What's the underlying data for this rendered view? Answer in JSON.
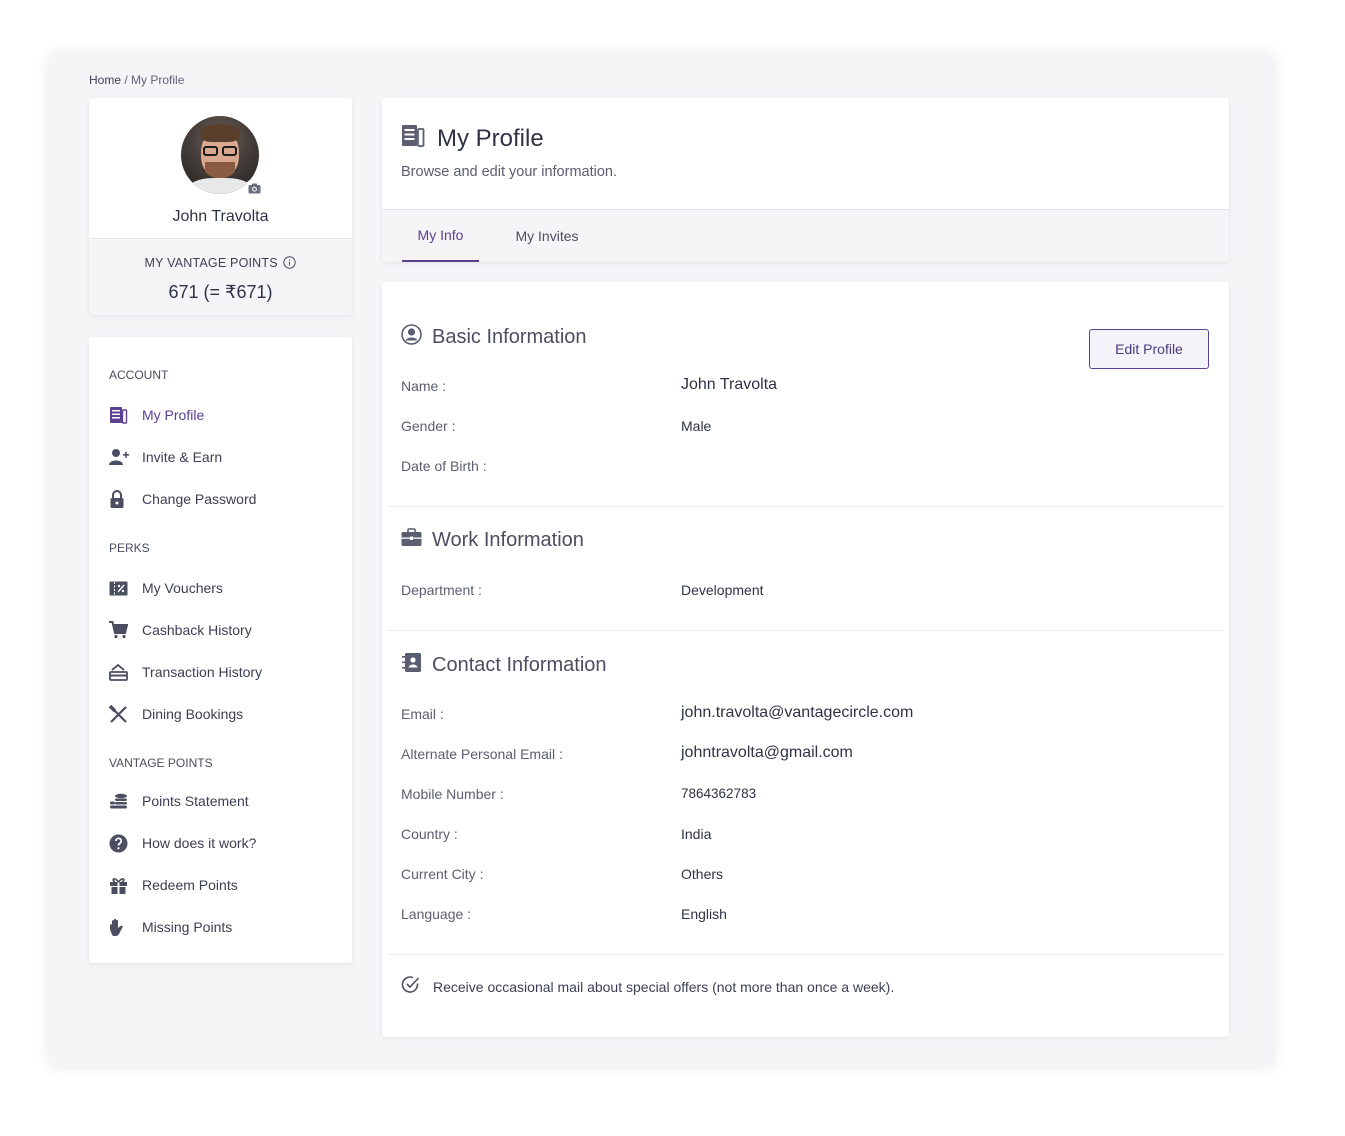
{
  "breadcrumb": {
    "home": "Home",
    "separator": " / ",
    "current": "My Profile"
  },
  "profile": {
    "name": "John Travolta",
    "points_label": "MY VANTAGE POINTS",
    "points_value": "671 (= ₹671)"
  },
  "sidebar": {
    "sections": {
      "account": "ACCOUNT",
      "perks": "PERKS",
      "vantage_points": "VANTAGE POINTS"
    },
    "items": [
      {
        "label": "My Profile",
        "icon": "profile-icon"
      },
      {
        "label": "Invite & Earn",
        "icon": "add-user-icon"
      },
      {
        "label": "Change Password",
        "icon": "lock-icon"
      },
      {
        "label": "My Vouchers",
        "icon": "voucher-icon"
      },
      {
        "label": "Cashback History",
        "icon": "cart-icon"
      },
      {
        "label": "Transaction History",
        "icon": "transaction-icon"
      },
      {
        "label": "Dining Bookings",
        "icon": "cutlery-icon"
      },
      {
        "label": "Points Statement",
        "icon": "coins-icon"
      },
      {
        "label": "How does it work?",
        "icon": "question-icon"
      },
      {
        "label": "Redeem Points",
        "icon": "gift-icon"
      },
      {
        "label": "Missing Points",
        "icon": "hand-icon"
      }
    ]
  },
  "header": {
    "title": "My Profile",
    "subtitle": "Browse and edit your information.",
    "tabs": [
      {
        "label": "My Info"
      },
      {
        "label": "My Invites"
      }
    ]
  },
  "basic": {
    "title": "Basic Information",
    "edit_label": "Edit Profile",
    "fields": [
      {
        "label": "Name :",
        "value": "John Travolta"
      },
      {
        "label": "Gender :",
        "value": "Male"
      },
      {
        "label": "Date of Birth :",
        "value": ""
      }
    ]
  },
  "work": {
    "title": "Work Information",
    "fields": [
      {
        "label": "Department :",
        "value": "Development"
      }
    ]
  },
  "contact": {
    "title": "Contact Information",
    "fields": [
      {
        "label": "Email :",
        "value": "john.travolta@vantagecircle.com"
      },
      {
        "label": "Alternate Personal Email :",
        "value": "johntravolta@gmail.com"
      },
      {
        "label": "Mobile Number :",
        "value": "7864362783"
      },
      {
        "label": "Country :",
        "value": "India"
      },
      {
        "label": "Current City :",
        "value": "Others"
      },
      {
        "label": "Language :",
        "value": "English"
      }
    ]
  },
  "optin": {
    "text": "Receive occasional mail about special offers (not more than once a week).",
    "checked": true
  },
  "colors": {
    "accent": "#5a3f93",
    "background": "#f5f5f8",
    "text": "#3b3f52"
  }
}
